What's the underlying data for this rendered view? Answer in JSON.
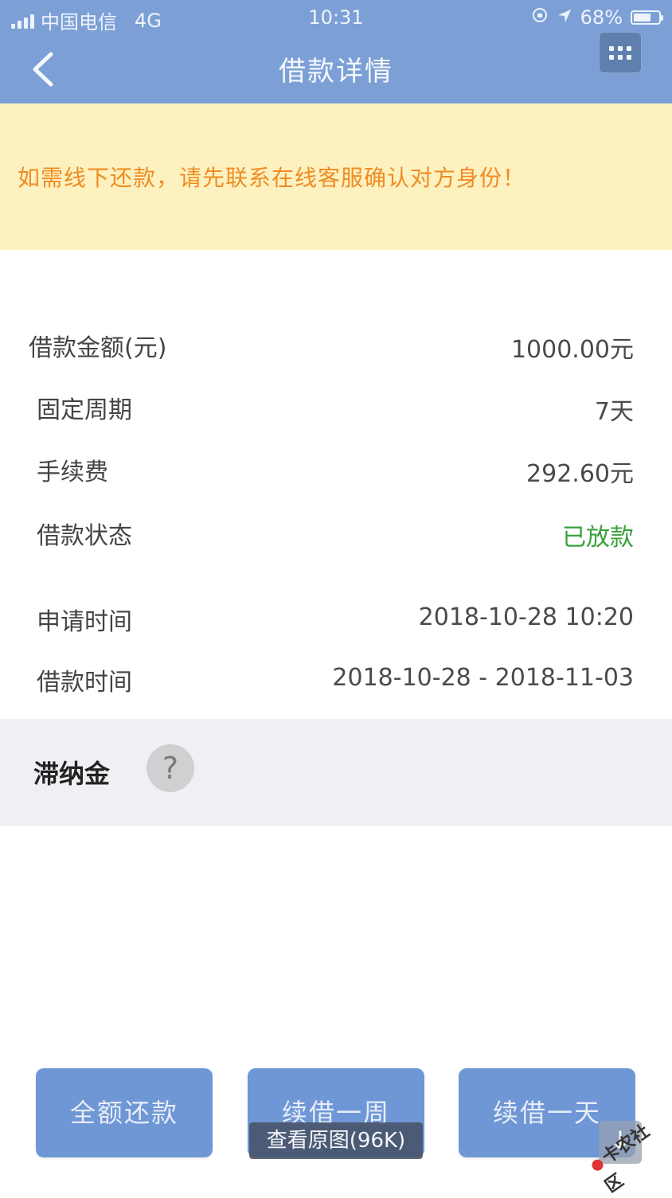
{
  "status_bar": {
    "carrier": "中国电信",
    "network": "4G",
    "time": "10:31",
    "battery": "68%",
    "battery_level": 0.68
  },
  "header": {
    "title": "借款详情",
    "back_icon": "chevron-left-icon",
    "menu_icon": "grid-menu-icon"
  },
  "notice": {
    "text": "如需线下还款，请先联系在线客服确认对方身份！"
  },
  "details": [
    {
      "label": "借款金额(元)",
      "value": "1000.00元"
    },
    {
      "label": "固定周期",
      "value": "7天"
    },
    {
      "label": "手续费",
      "value": "292.60元"
    },
    {
      "label": "借款状态",
      "value": "已放款",
      "color": "#3aa03c"
    },
    {
      "label": "申请时间",
      "value": "2018-10-28 10:20"
    },
    {
      "label": "借款时间",
      "value": "2018-10-28 - 2018-11-03"
    }
  ],
  "late_fee": {
    "label": "滞纳金",
    "help": "?"
  },
  "buttons": {
    "repay_full": "全额还款",
    "extend_week": "续借一周",
    "extend_day": "续借一天"
  },
  "overlay": {
    "view_original": "查看原图(96K)",
    "download": "↓",
    "watermark": "卡农社区"
  },
  "colors": {
    "header": "#7ca0d6",
    "notice_bg": "#fdf1c0",
    "notice_text": "#f08c24",
    "button": "#6f97d6",
    "status_green": "#3aa03c"
  }
}
